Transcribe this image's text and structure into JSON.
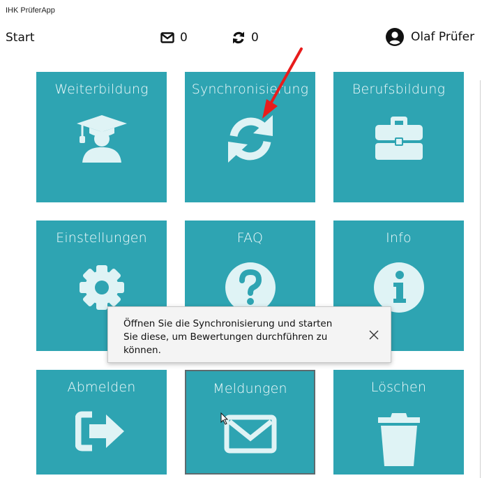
{
  "app": {
    "title": "IHK PrüferApp"
  },
  "header": {
    "start_label": "Start",
    "mail_count": "0",
    "sync_count": "0",
    "user_name": "Olaf Prüfer"
  },
  "tiles": [
    {
      "label": "Weiterbildung",
      "icon": "graduate-icon"
    },
    {
      "label": "Synchronisierung",
      "icon": "sync-icon"
    },
    {
      "label": "Berufsbildung",
      "icon": "briefcase-icon"
    },
    {
      "label": "Einstellungen",
      "icon": "gear-icon"
    },
    {
      "label": "FAQ",
      "icon": "question-icon"
    },
    {
      "label": "Info",
      "icon": "info-icon"
    },
    {
      "label": "Abmelden",
      "icon": "logout-icon"
    },
    {
      "label": "Meldungen",
      "icon": "mail-icon"
    },
    {
      "label": "Löschen",
      "icon": "trash-icon"
    }
  ],
  "toast": {
    "message": "Öffnen Sie die Synchronisierung und starten Sie diese, um Bewertungen durchführen zu können."
  },
  "colors": {
    "tile": "#2ea4b2",
    "icon": "#dff3f5",
    "annotation_arrow": "#e81c1c"
  }
}
